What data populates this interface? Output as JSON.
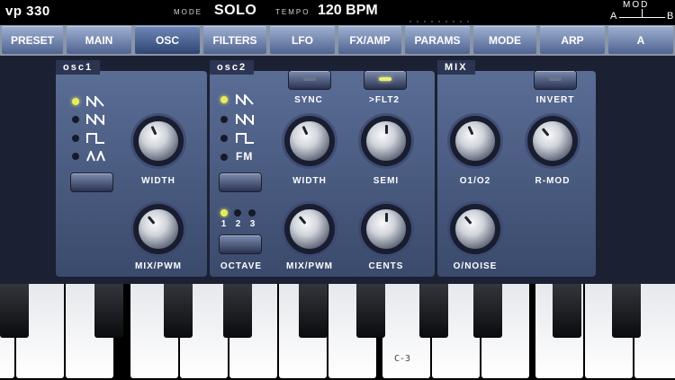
{
  "topbar": {
    "app_name": "vp 330",
    "mode_label": "MODE",
    "mode_value": "SOLO",
    "tempo_label": "TEMPO",
    "tempo_value": "120 BPM",
    "mod_label": "MOD",
    "mod_a": "A",
    "mod_b": "B"
  },
  "tabs": [
    {
      "label": "PRESET",
      "active": false
    },
    {
      "label": "MAIN",
      "active": false
    },
    {
      "label": "OSC",
      "active": true
    },
    {
      "label": "FILTERS",
      "active": false
    },
    {
      "label": "LFO",
      "active": false
    },
    {
      "label": "FX/AMP",
      "active": false
    },
    {
      "label": "PARAMS",
      "active": false
    },
    {
      "label": "MODE",
      "active": false
    },
    {
      "label": "ARP",
      "active": false
    },
    {
      "label": "A",
      "active": false
    }
  ],
  "osc1": {
    "title": "osc1",
    "width_label": "WIDTH",
    "mixpwm_label": "MIX/PWM",
    "selected_wave": 0
  },
  "osc2": {
    "title": "osc2",
    "sync_label": "SYNC",
    "flt2_label": ">FLT2",
    "width_label": "WIDTH",
    "semi_label": "SEMI",
    "mixpwm_label": "MIX/PWM",
    "cents_label": "CENTS",
    "octave_label": "OCTAVE",
    "octave_options": [
      "1",
      "2",
      "3"
    ],
    "fm_label": "FM",
    "selected_wave": 0,
    "selected_octave": 0
  },
  "mix": {
    "title": "MIX",
    "invert_label": "INVERT",
    "o1o2_label": "O1/O2",
    "rmod_label": "R-MOD",
    "onoise_label": "O/NOISE"
  },
  "keyboard": {
    "c3_label": "C-3"
  }
}
